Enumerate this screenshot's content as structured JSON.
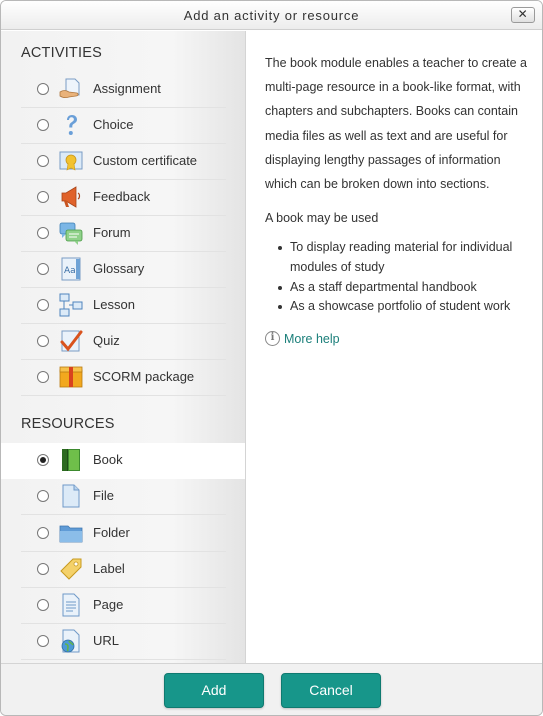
{
  "dialog": {
    "title": "Add an activity or resource",
    "close_label": "✕"
  },
  "activities": {
    "heading": "ACTIVITIES",
    "items": [
      {
        "label": "Assignment",
        "icon": "assignment-icon"
      },
      {
        "label": "Choice",
        "icon": "choice-icon"
      },
      {
        "label": "Custom certificate",
        "icon": "certificate-icon"
      },
      {
        "label": "Feedback",
        "icon": "feedback-icon"
      },
      {
        "label": "Forum",
        "icon": "forum-icon"
      },
      {
        "label": "Glossary",
        "icon": "glossary-icon"
      },
      {
        "label": "Lesson",
        "icon": "lesson-icon"
      },
      {
        "label": "Quiz",
        "icon": "quiz-icon"
      },
      {
        "label": "SCORM package",
        "icon": "scorm-icon"
      }
    ]
  },
  "resources": {
    "heading": "RESOURCES",
    "selected": "Book",
    "items": [
      {
        "label": "Book",
        "icon": "book-icon"
      },
      {
        "label": "File",
        "icon": "file-icon"
      },
      {
        "label": "Folder",
        "icon": "folder-icon"
      },
      {
        "label": "Label",
        "icon": "label-icon"
      },
      {
        "label": "Page",
        "icon": "page-icon"
      },
      {
        "label": "URL",
        "icon": "url-icon"
      }
    ]
  },
  "description": {
    "intro": "The book module enables a teacher to create a multi-page resource in a book-like format, with chapters and subchapters. Books can contain media files as well as text and are useful for displaying lengthy passages of information which can be broken down into sections.",
    "used_heading": "A book may be used",
    "uses": [
      "To display reading material for individual modules of study",
      "As a staff departmental handbook",
      "As a showcase portfolio of student work"
    ],
    "more_help": "More help"
  },
  "footer": {
    "add_label": "Add",
    "cancel_label": "Cancel"
  },
  "colors": {
    "accent": "#17968a",
    "link": "#1b7f7a"
  }
}
